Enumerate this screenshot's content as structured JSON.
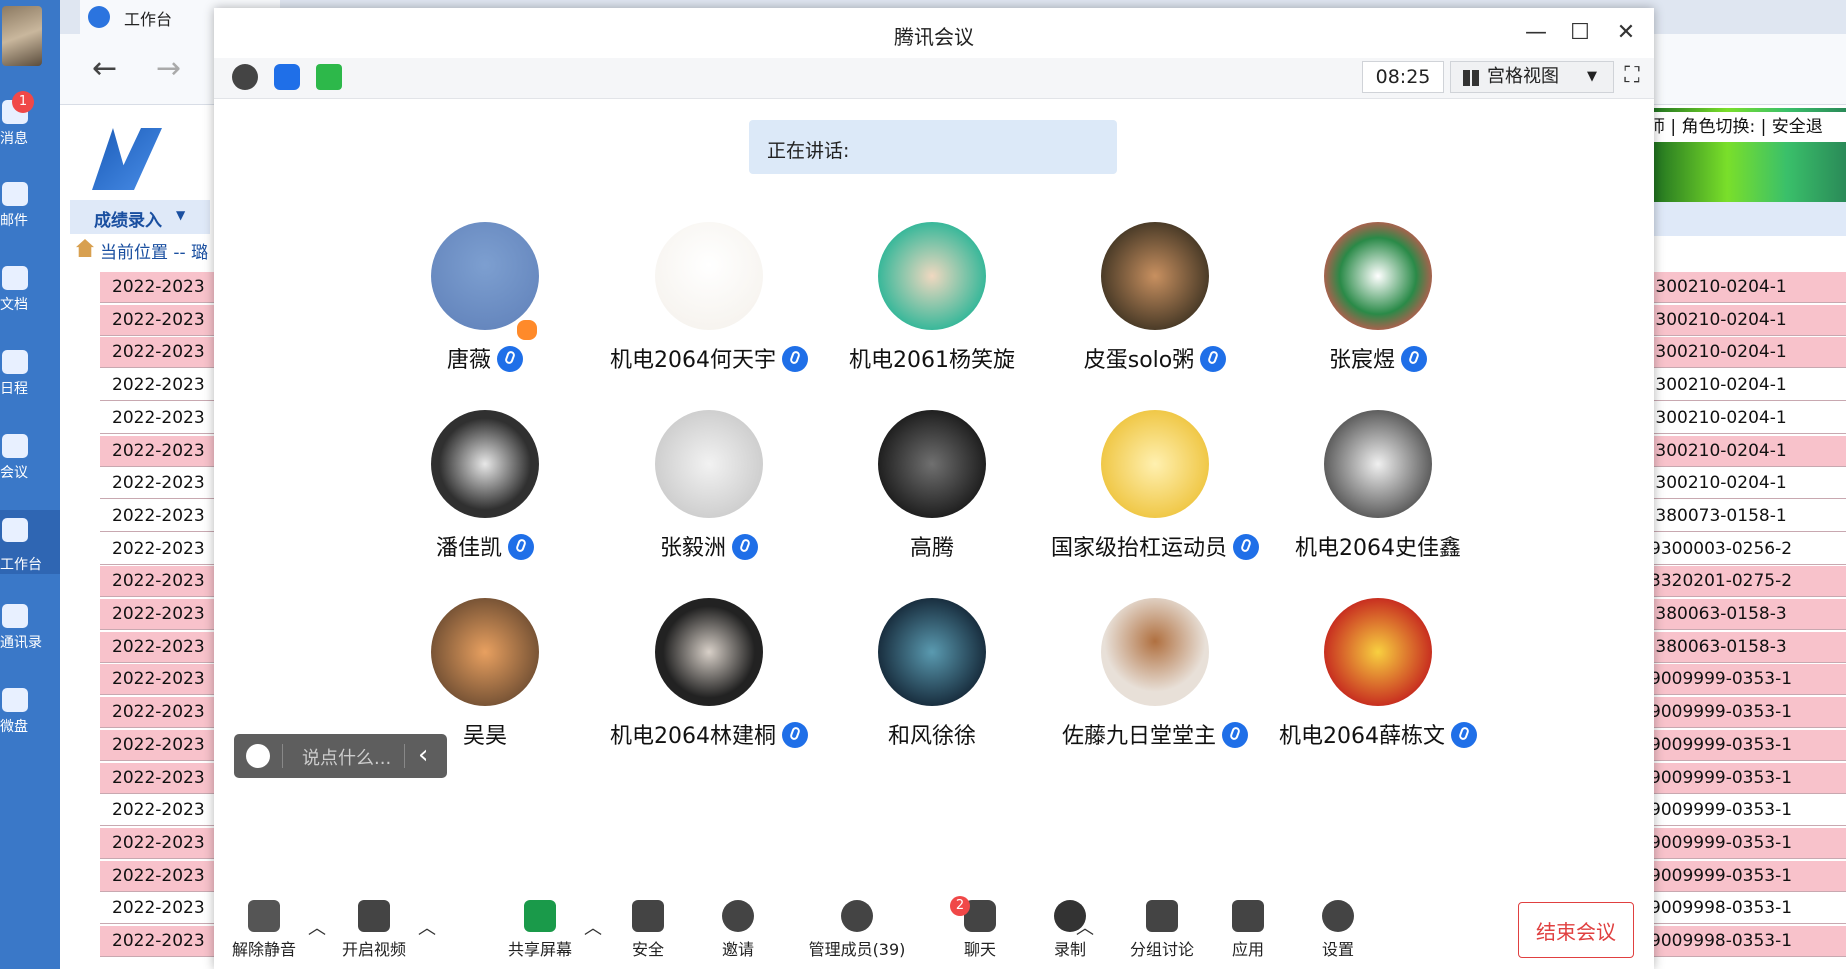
{
  "sidebar": {
    "badge": "1",
    "items": [
      {
        "label": "消息"
      },
      {
        "label": "邮件"
      },
      {
        "label": "文档"
      },
      {
        "label": "日程"
      },
      {
        "label": "会议"
      },
      {
        "label": "工作台"
      },
      {
        "label": "通讯录"
      },
      {
        "label": "微盘"
      }
    ]
  },
  "browser": {
    "tab_title": "工作台",
    "menu_label": "成绩录入",
    "breadcrumb": "当前位置 -- 璐",
    "role_text": "师 | 角色切换: | 安全退",
    "left_rows": [
      "2022-2023",
      "2022-2023",
      "2022-2023",
      "2022-2023",
      "2022-2023",
      "2022-2023",
      "2022-2023",
      "2022-2023",
      "2022-2023",
      "2022-2023",
      "2022-2023",
      "2022-2023",
      "2022-2023",
      "2022-2023",
      "2022-2023",
      "2022-2023",
      "2022-2023",
      "2022-2023",
      "2022-2023",
      "2022-2023",
      "2022-2023"
    ],
    "right_rows": [
      ".300210-0204-1",
      ".300210-0204-1",
      ".300210-0204-1",
      ".300210-0204-1",
      ".300210-0204-1",
      ".300210-0204-1",
      ".300210-0204-1",
      ".380073-0158-1",
      "9300003-0256-2",
      "3320201-0275-2",
      ".380063-0158-3",
      ".380063-0158-3",
      "9009999-0353-1",
      "9009999-0353-1",
      "9009999-0353-1",
      "9009999-0353-1",
      "9009999-0353-1",
      "9009999-0353-1",
      "9009999-0353-1",
      "9009998-0353-1",
      "9009998-0353-1"
    ]
  },
  "meeting": {
    "window_title": "腾讯会议",
    "timer": "08:25",
    "view_mode": "宫格视图",
    "speaking_label": "正在讲话:",
    "participants": [
      {
        "name": "唐薇",
        "mic": true
      },
      {
        "name": "机电2064何天宇",
        "mic": true
      },
      {
        "name": "机电2061杨笑旋",
        "mic": false
      },
      {
        "name": "皮蛋solo粥",
        "mic": true
      },
      {
        "name": "张宸煜",
        "mic": true
      },
      {
        "name": "潘佳凯",
        "mic": true
      },
      {
        "name": "张毅洲",
        "mic": true
      },
      {
        "name": "高腾",
        "mic": false
      },
      {
        "name": "国家级抬杠运动员",
        "mic": true
      },
      {
        "name": "机电2064史佳鑫",
        "mic": false
      },
      {
        "name": "吴昊",
        "mic": false
      },
      {
        "name": "机电2064林建桐",
        "mic": true
      },
      {
        "name": "和风徐徐",
        "mic": false
      },
      {
        "name": "佐藤九日堂堂主",
        "mic": true
      },
      {
        "name": "机电2064薛栋文",
        "mic": true
      }
    ],
    "chat_placeholder": "说点什么...",
    "toolbar": {
      "unmute": "解除静音",
      "video": "开启视频",
      "share": "共享屏幕",
      "security": "安全",
      "invite": "邀请",
      "members": "管理成员(39)",
      "chat": "聊天",
      "chat_badge": "2",
      "record": "录制",
      "breakout": "分组讨论",
      "apps": "应用",
      "settings": "设置",
      "end": "结束会议"
    }
  }
}
